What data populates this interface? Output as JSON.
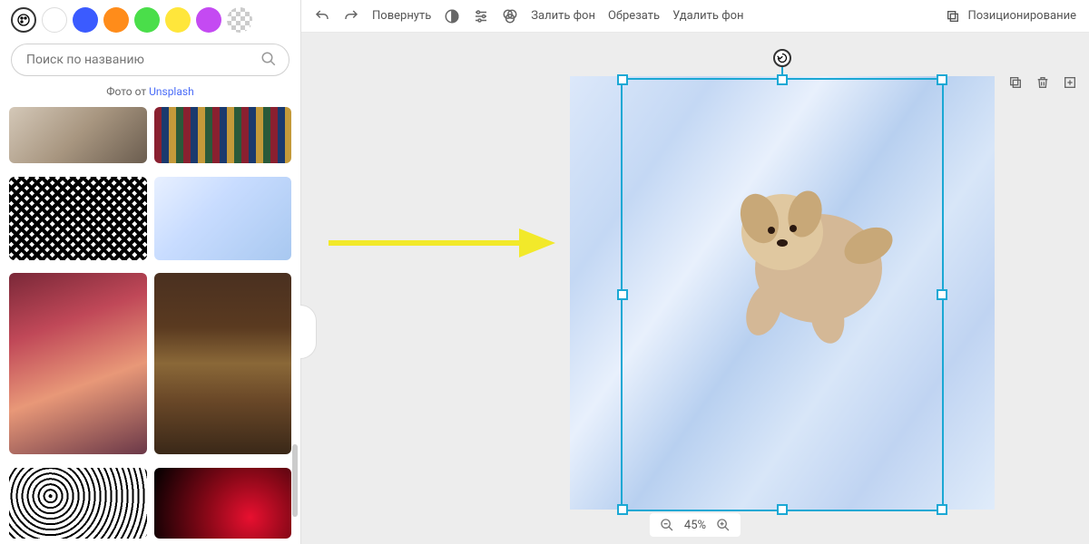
{
  "sidebar": {
    "search_placeholder": "Поиск по названию",
    "credit_prefix": "Фото от ",
    "credit_link": "Unsplash",
    "colors": [
      "white",
      "blue",
      "orange",
      "green",
      "yellow",
      "purple",
      "transparent"
    ]
  },
  "toolbar": {
    "rotate": "Повернуть",
    "fill_bg": "Залить фон",
    "crop": "Обрезать",
    "remove_bg": "Удалить фон",
    "positioning": "Позиционирование"
  },
  "zoom": {
    "value": "45%"
  }
}
